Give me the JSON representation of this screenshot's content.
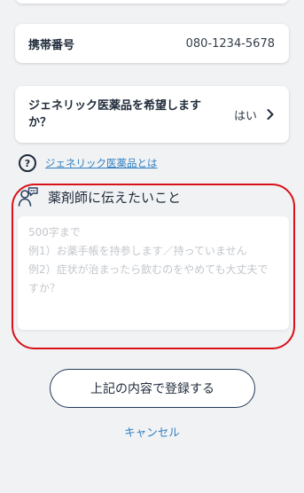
{
  "phone": {
    "label": "携帯番号",
    "value": "080-1234-5678"
  },
  "generic": {
    "question": "ジェネリック医薬品を希望しますか？",
    "answer": "はい"
  },
  "help": {
    "icon_text": "?",
    "link_label": "ジェネリック医薬品とは"
  },
  "memo": {
    "title": "薬剤師に伝えたいこと",
    "placeholder": "500字まで\n例1）お薬手帳を持参します／持っていません\n例2）症状が治まったら飲むのをやめても大丈夫ですか？"
  },
  "actions": {
    "register_label": "上記の内容で登録する",
    "cancel_label": "キャンセル"
  },
  "colors": {
    "accent": "#2f7fc1",
    "highlight": "#d9111b",
    "text": "#1f2b3a"
  }
}
